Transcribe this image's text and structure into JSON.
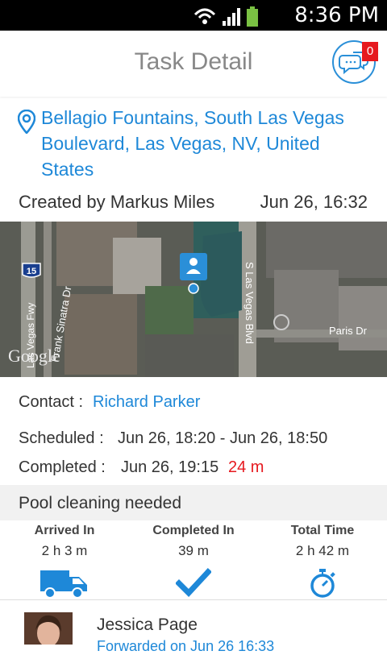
{
  "status_bar": {
    "time": "8:36 PM",
    "icons": [
      "wifi-icon",
      "signal-icon",
      "battery-icon"
    ]
  },
  "header": {
    "title": "Task Detail",
    "chat_badge": "0"
  },
  "task": {
    "address": "Bellagio Fountains, South Las Vegas Boulevard, Las Vegas, NV, United States",
    "created_by": "Created by Markus Miles",
    "created_date": "Jun 26, 16:32"
  },
  "map": {
    "labels": {
      "i15": "15",
      "frank_sinatra": "Frank Sinatra Dr",
      "vegas_fwy": "Las Vegas Fwy",
      "s_las_vegas_blvd": "S Las Vegas Blvd",
      "paris_dr": "Paris Dr",
      "google": "Google"
    }
  },
  "details": {
    "contact_label": "Contact :",
    "contact_name": "Richard Parker",
    "scheduled_label": "Scheduled :",
    "scheduled_value": "Jun 26, 18:20 - Jun 26, 18:50",
    "completed_label": "Completed :",
    "completed_value": "Jun 26, 19:15",
    "completed_late": "24 m"
  },
  "note": "Pool cleaning needed",
  "stats": [
    {
      "label": "Arrived In",
      "value": "2 h 3 m",
      "icon": "truck-icon"
    },
    {
      "label": "Completed In",
      "value": "39 m",
      "icon": "checkmark-icon"
    },
    {
      "label": "Total Time",
      "value": "2 h 42 m",
      "icon": "stopwatch-icon"
    }
  ],
  "assignee": {
    "name": "Jessica Page",
    "sub": "Forwarded on Jun 26 16:33"
  },
  "colors": {
    "accent": "#1e88d8",
    "late": "#e6191f"
  }
}
